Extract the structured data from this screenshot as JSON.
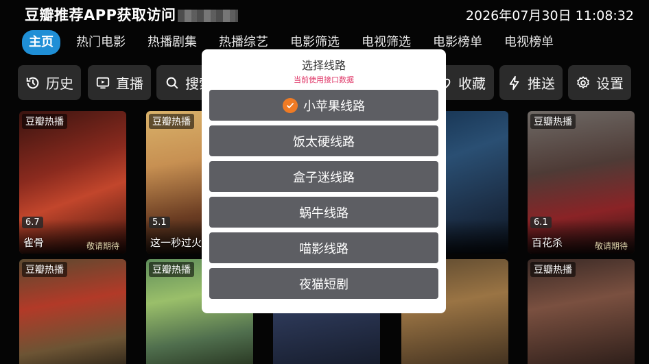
{
  "header": {
    "title": "豆瓣推荐APP获取访问",
    "clock": "2026年07月30日 11:08:32"
  },
  "tabs": [
    {
      "label": "主页",
      "active": true
    },
    {
      "label": "热门电影"
    },
    {
      "label": "热播剧集"
    },
    {
      "label": "热播综艺"
    },
    {
      "label": "电影筛选"
    },
    {
      "label": "电视筛选"
    },
    {
      "label": "电影榜单"
    },
    {
      "label": "电视榜单"
    }
  ],
  "toolbar": {
    "history": "历史",
    "live": "直播",
    "search": "搜索",
    "favorites": "收藏",
    "push": "推送",
    "settings": "设置"
  },
  "posters": [
    {
      "badge": "豆瓣热播",
      "score": "6.7",
      "title": "雀骨",
      "subtitle": "敬请期待"
    },
    {
      "badge": "豆瓣热播",
      "score": "5.1",
      "title": "这一秒过火"
    },
    {
      "badge": "豆瓣热播",
      "score": "",
      "title": ""
    },
    {
      "badge": "",
      "score": "",
      "title": ""
    },
    {
      "badge": "",
      "score": "",
      "title": ""
    },
    {
      "badge": "豆瓣热播",
      "score": "6.1",
      "title": "百花杀",
      "subtitle": "敬请期待"
    },
    {
      "badge": "豆瓣热播",
      "title": ""
    },
    {
      "badge": "豆瓣热播",
      "title": ""
    },
    {
      "badge": "",
      "title": ""
    },
    {
      "badge": "",
      "title": ""
    },
    {
      "badge": "",
      "title": ""
    },
    {
      "badge": "豆瓣热播",
      "title": ""
    }
  ],
  "dialog": {
    "title": "选择线路",
    "subtitle": "当前使用接口数据",
    "routes": [
      {
        "label": "小苹果线路",
        "selected": true
      },
      {
        "label": "饭太硬线路"
      },
      {
        "label": "盒子迷线路"
      },
      {
        "label": "蜗牛线路"
      },
      {
        "label": "喵影线路"
      },
      {
        "label": "夜猫短剧"
      }
    ]
  },
  "colors": {
    "accent": "#1f8fd6",
    "selected_check": "#f07b24",
    "subtitle_pink": "#e03a6a"
  }
}
